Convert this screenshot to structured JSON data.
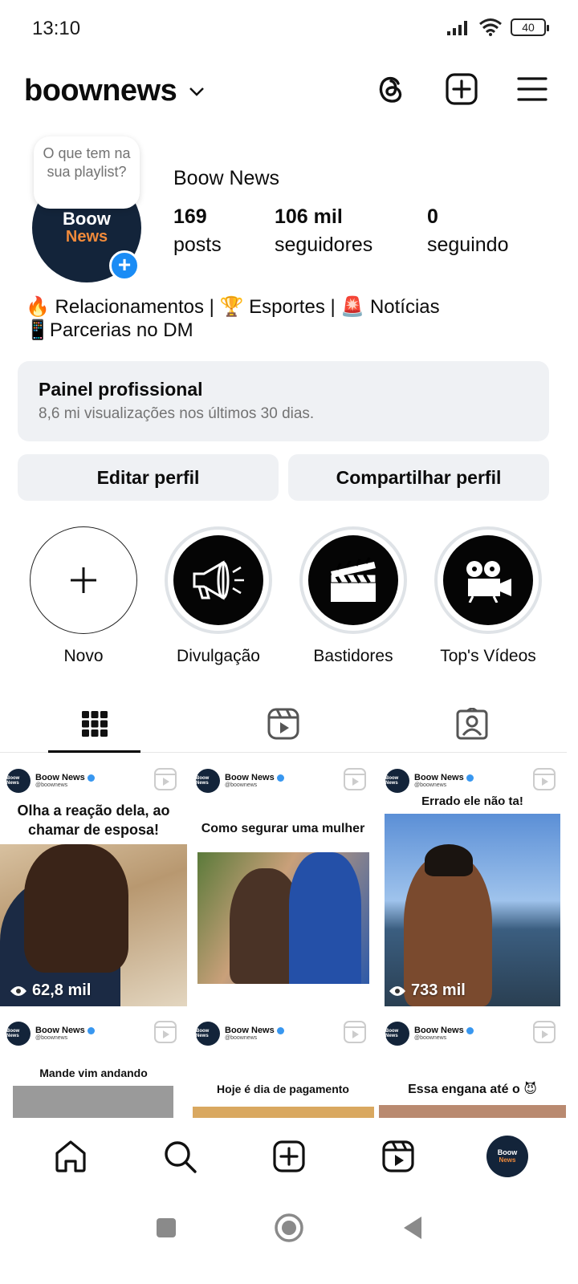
{
  "status_bar": {
    "time": "13:10",
    "battery": "40"
  },
  "header": {
    "username": "boownews"
  },
  "profile": {
    "note": "O que tem na sua playlist?",
    "avatar_line1": "Boow",
    "avatar_line2": "News",
    "display_name": "Boow News",
    "stats": [
      {
        "value": "169",
        "label": "posts"
      },
      {
        "value": "106 mil",
        "label": "seguidores"
      },
      {
        "value": "0",
        "label": "seguindo"
      }
    ],
    "bio_line1": "🔥 Relacionamentos | 🏆 Esportes | 🚨 Notícias",
    "bio_line2": "📱Parcerias no DM"
  },
  "dashboard": {
    "title": "Painel profissional",
    "subtitle": "8,6 mi visualizações nos últimos 30 dias."
  },
  "buttons": {
    "edit": "Editar perfil",
    "share": "Compartilhar perfil"
  },
  "highlights": [
    {
      "label": "Novo",
      "icon": "plus-icon"
    },
    {
      "label": "Divulgação",
      "icon": "megaphone-icon"
    },
    {
      "label": "Bastidores",
      "icon": "clapperboard-icon"
    },
    {
      "label": "Top's Vídeos",
      "icon": "film-projector-icon"
    }
  ],
  "posts": [
    {
      "name": "Boow News",
      "handle": "@boownews",
      "caption": "Olha a reação dela, ao chamar de esposa!",
      "views": "62,8 mil"
    },
    {
      "name": "Boow News",
      "handle": "@boownews",
      "caption": "Como segurar uma mulher",
      "views": ""
    },
    {
      "name": "Boow News",
      "handle": "@boownews",
      "caption": "Errado ele não ta!",
      "views": "733 mil"
    },
    {
      "name": "Boow News",
      "handle": "@boownews",
      "caption": "Mande vim andando",
      "views": ""
    },
    {
      "name": "Boow News",
      "handle": "@boownews",
      "caption": "Hoje é dia de pagamento",
      "views": ""
    },
    {
      "name": "Boow News",
      "handle": "@boownews",
      "caption": "Essa engana até o 😈",
      "views": ""
    }
  ],
  "mini_avatar": "Boow News",
  "colors": {
    "accent_blue": "#1a8cf5",
    "avatar_bg": "#13243a",
    "brand_orange": "#f08a3a",
    "card_bg": "#eff1f4"
  }
}
